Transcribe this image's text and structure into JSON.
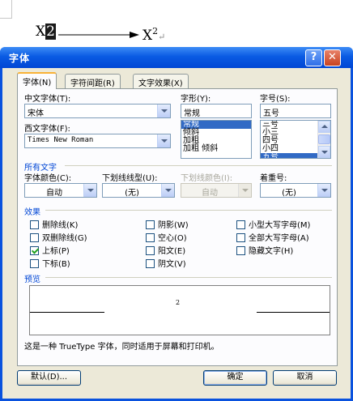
{
  "document": {
    "left_base": "X",
    "left_selected": "2",
    "right_base": "X",
    "right_sup": "2",
    "para_mark": "↵"
  },
  "dialog": {
    "title": "字体",
    "help_label": "?",
    "close_label": "✕"
  },
  "tabs": [
    {
      "label": "字体(N)",
      "active": true
    },
    {
      "label": "字符间距(R)",
      "active": false
    },
    {
      "label": "文字效果(X)",
      "active": false
    }
  ],
  "font": {
    "cn_font_label": "中文字体(T):",
    "cn_font_value": "宋体",
    "west_font_label": "西文字体(F):",
    "west_font_value": "Times New Roman",
    "style_label": "字形(Y):",
    "style_value": "常规",
    "style_list": [
      "常规",
      "倾斜",
      "加粗",
      "加粗 倾斜"
    ],
    "style_selected": 0,
    "size_label": "字号(S):",
    "size_value": "五号",
    "size_list": [
      "三号",
      "小三",
      "四号",
      "小四",
      "五号"
    ],
    "size_selected": 4
  },
  "all_text": {
    "group_title": "所有文字",
    "color_label": "字体颜色(C):",
    "color_value": "自动",
    "underline_label": "下划线线型(U):",
    "underline_value": "(无)",
    "underline_color_label": "下划线颜色(I):",
    "underline_color_value": "自动",
    "emphasis_label": "着重号:",
    "emphasis_value": "(无)"
  },
  "effects": {
    "group_title": "效果",
    "items": [
      {
        "label": "删除线(K)",
        "checked": false
      },
      {
        "label": "双删除线(G)",
        "checked": false
      },
      {
        "label": "上标(P)",
        "checked": true
      },
      {
        "label": "下标(B)",
        "checked": false
      },
      {
        "label": "阴影(W)",
        "checked": false
      },
      {
        "label": "空心(O)",
        "checked": false
      },
      {
        "label": "阳文(E)",
        "checked": false
      },
      {
        "label": "阴文(V)",
        "checked": false
      },
      {
        "label": "小型大写字母(M)",
        "checked": false
      },
      {
        "label": "全部大写字母(A)",
        "checked": false
      },
      {
        "label": "隐藏文字(H)",
        "checked": false
      }
    ]
  },
  "preview": {
    "group_title": "预览",
    "sample": "2",
    "note": "这是一种 TrueType 字体，同时适用于屏幕和打印机。"
  },
  "buttons": {
    "default_label": "默认(D)...",
    "ok_label": "确定",
    "cancel_label": "取消"
  },
  "colors": {
    "title_bar": "#0a52de",
    "dialog_face": "#ece9d8",
    "group_title": "#0046d5",
    "selection": "#316ac5"
  }
}
